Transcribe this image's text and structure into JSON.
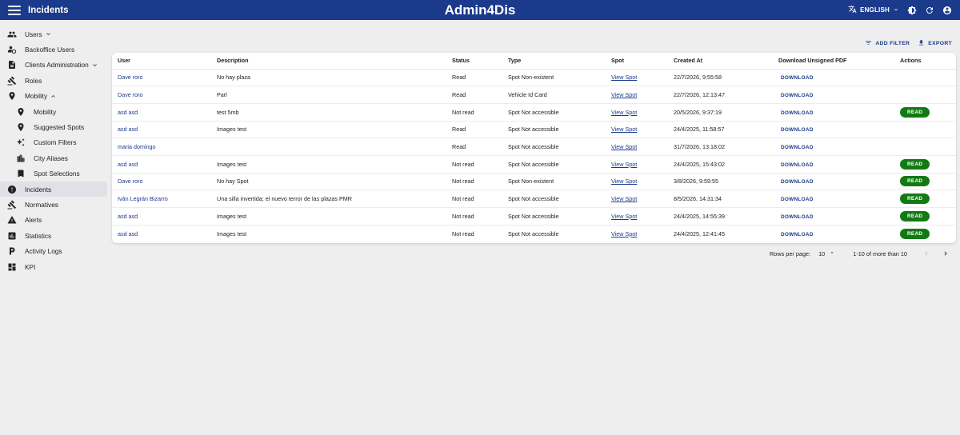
{
  "appbar": {
    "page_title": "Incidents",
    "brand": "Admin4Dis",
    "language": "ENGLISH"
  },
  "sidebar": {
    "items": [
      {
        "label": "Users",
        "icon": "users-icon",
        "expandable": true
      },
      {
        "label": "Backoffice Users",
        "icon": "backoffice-users-icon"
      },
      {
        "label": "Clients Administration",
        "icon": "clients-icon",
        "expandable": true
      },
      {
        "label": "Roles",
        "icon": "gavel-icon"
      },
      {
        "label": "Mobility",
        "icon": "location-pin-icon",
        "expanded": true
      },
      {
        "label": "Mobility",
        "icon": "location-pin-icon",
        "sub": true
      },
      {
        "label": "Suggested Spots",
        "icon": "location-pin-icon",
        "sub": true
      },
      {
        "label": "Custom Filters",
        "icon": "sparkle-icon",
        "sub": true
      },
      {
        "label": "City Aliases",
        "icon": "city-icon",
        "sub": true
      },
      {
        "label": "Spot Selections",
        "icon": "bookmark-icon",
        "sub": true
      },
      {
        "label": "Incidents",
        "icon": "alert-circle-icon",
        "active": true
      },
      {
        "label": "Normatives",
        "icon": "gavel-icon"
      },
      {
        "label": "Alerts",
        "icon": "warning-icon"
      },
      {
        "label": "Statistics",
        "icon": "statistics-icon"
      },
      {
        "label": "Activity Logs",
        "icon": "parking-icon"
      },
      {
        "label": "KPI",
        "icon": "dashboard-icon"
      }
    ]
  },
  "toolbar": {
    "add_filter": "ADD FILTER",
    "export": "EXPORT"
  },
  "table": {
    "columns": [
      "User",
      "Description",
      "Status",
      "Type",
      "Spot",
      "Created At",
      "Download Unsigned PDF",
      "Actions"
    ],
    "rows": [
      {
        "user": "Dave roro",
        "description": "No hay plaza",
        "status": "Read",
        "type": "Spot Non-existent",
        "spot": "View Spot",
        "created": "22/7/2026, 9:55:58",
        "download": "DOWNLOAD",
        "action": ""
      },
      {
        "user": "Dave roro",
        "description": "Parl",
        "status": "Read",
        "type": "Vehicle Id Card",
        "spot": "View Spot",
        "created": "22/7/2026, 12:13:47",
        "download": "DOWNLOAD",
        "action": ""
      },
      {
        "user": "asd asd",
        "description": "test 5mb",
        "status": "Not read",
        "type": "Spot Not accessible",
        "spot": "View Spot",
        "created": "20/5/2026, 9:37:19",
        "download": "DOWNLOAD",
        "action": "READ"
      },
      {
        "user": "asd asd",
        "description": "Images test",
        "status": "Read",
        "type": "Spot Not accessible",
        "spot": "View Spot",
        "created": "24/4/2025, 11:58:57",
        "download": "DOWNLOAD",
        "action": ""
      },
      {
        "user": "maria domingo",
        "description": "",
        "status": "Read",
        "type": "Spot Not accessible",
        "spot": "View Spot",
        "created": "31/7/2026, 13:18:02",
        "download": "DOWNLOAD",
        "action": ""
      },
      {
        "user": "asd asd",
        "description": "Images test",
        "status": "Not read",
        "type": "Spot Not accessible",
        "spot": "View Spot",
        "created": "24/4/2025, 15:43:02",
        "download": "DOWNLOAD",
        "action": "READ"
      },
      {
        "user": "Dave roro",
        "description": "No hay Spot",
        "status": "Not read",
        "type": "Spot Non-existent",
        "spot": "View Spot",
        "created": "3/8/2026, 9:59:55",
        "download": "DOWNLOAD",
        "action": "READ"
      },
      {
        "user": "Iván Legrán Bizarro",
        "description": "Una silla invertida; el nuevo terror de las plazas PMR",
        "status": "Not read",
        "type": "Spot Not accessible",
        "spot": "View Spot",
        "created": "8/5/2026, 14:31:34",
        "download": "DOWNLOAD",
        "action": "READ"
      },
      {
        "user": "asd asd",
        "description": "Images test",
        "status": "Not read",
        "type": "Spot Not accessible",
        "spot": "View Spot",
        "created": "24/4/2025, 14:55:39",
        "download": "DOWNLOAD",
        "action": "READ"
      },
      {
        "user": "asd asd",
        "description": "Images test",
        "status": "Not read",
        "type": "Spot Not accessible",
        "spot": "View Spot",
        "created": "24/4/2025, 12:41:45",
        "download": "DOWNLOAD",
        "action": "READ"
      }
    ]
  },
  "pagination": {
    "rows_per_page_label": "Rows per page:",
    "rows_per_page_value": "10",
    "range": "1-10 of more than 10"
  },
  "colors": {
    "primary": "#1b3a8c",
    "read_button": "#137a13"
  }
}
